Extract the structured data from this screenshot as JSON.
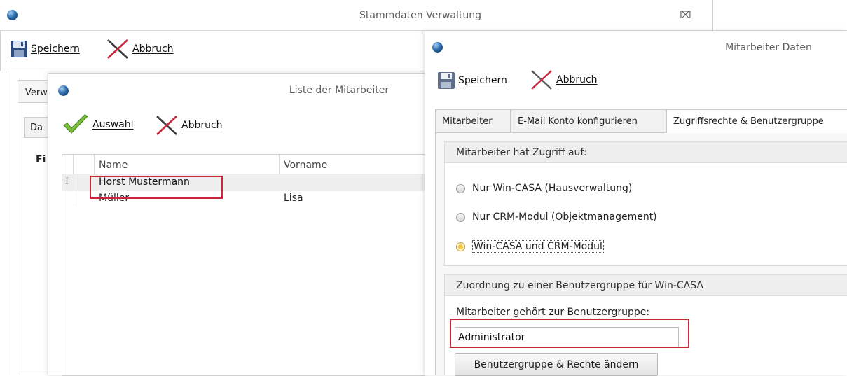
{
  "main_window": {
    "title": "Stammdaten Verwaltung",
    "close_glyph": "⌧",
    "toolbar": {
      "save_label": "Speichern",
      "cancel_label": "Abbruch"
    },
    "tab_partial_1": "Verw",
    "tab_partial_2": "Da",
    "label_partial": "Fi"
  },
  "list_window": {
    "title": "Liste der Mitarbeiter",
    "toolbar": {
      "select_label": "Auswahl",
      "cancel_label": "Abbruch"
    },
    "grid": {
      "columns": [
        "Name",
        "Vorname"
      ],
      "rows": [
        {
          "name": "Horst Mustermann",
          "vorname": ""
        },
        {
          "name": "Müller",
          "vorname": "Lisa"
        }
      ],
      "row_cursor_glyph": "I"
    }
  },
  "detail_window": {
    "title": "Mitarbeiter Daten",
    "toolbar": {
      "save_label": "Speichern",
      "cancel_label": "Abbruch"
    },
    "tabs": [
      {
        "label": "Mitarbeiter",
        "active": false
      },
      {
        "label": "E-Mail Konto konfigurieren",
        "active": false
      },
      {
        "label": "Zugriffsrechte & Benutzergruppe",
        "active": true
      }
    ],
    "access": {
      "heading": "Mitarbeiter hat Zugriff auf:",
      "options": [
        {
          "label": "Nur Win-CASA (Hausverwaltung)",
          "checked": false
        },
        {
          "label": "Nur CRM-Modul (Objektmanagement)",
          "checked": false
        },
        {
          "label": "Win-CASA und CRM-Modul",
          "checked": true
        }
      ]
    },
    "group": {
      "heading": "Zuordnung zu einer Benutzergruppe für Win-CASA",
      "field_label": "Mitarbeiter gehört zur Benutzergruppe:",
      "field_value": "Administrator",
      "change_button": "Benutzergruppe & Rechte ändern"
    }
  },
  "colors": {
    "highlight_red": "#c8283a",
    "accent_yellow": "#f2c53d",
    "tab_bg": "#f2f2f2"
  }
}
